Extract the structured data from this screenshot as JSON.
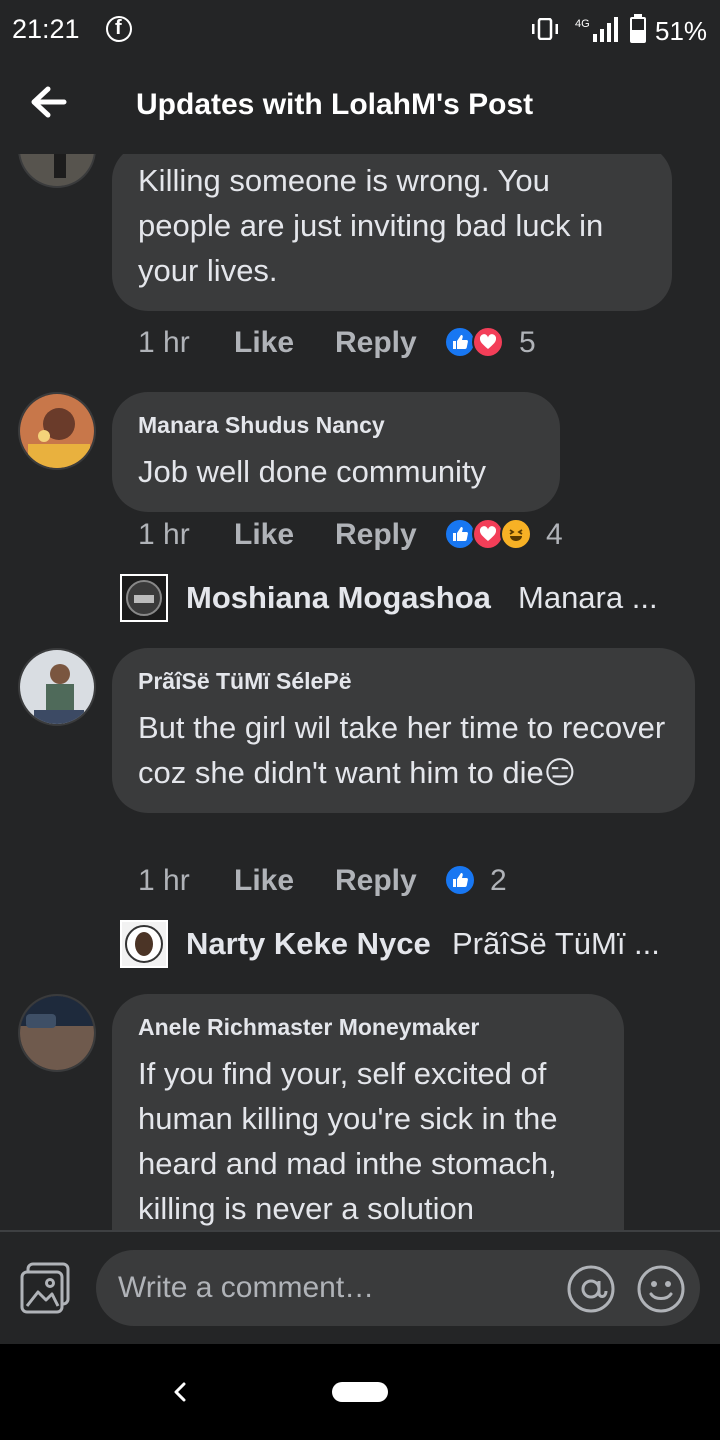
{
  "status_bar": {
    "time": "21:21",
    "network": "4G",
    "battery_percent": "51%",
    "battery_level": 0.51
  },
  "header": {
    "title": "Updates with LolahM's Post"
  },
  "comments": [
    {
      "name": "",
      "text": "Killing someone is wrong. You people are just inviting bad luck in your lives.",
      "time": "1 hr",
      "like_label": "Like",
      "reply_label": "Reply",
      "reactions": [
        "like",
        "love"
      ],
      "reaction_count": "5"
    },
    {
      "name": "Manara Shudus Nancy",
      "text": "Job well done community",
      "time": "1 hr",
      "like_label": "Like",
      "reply_label": "Reply",
      "reactions": [
        "like",
        "love",
        "haha"
      ],
      "reaction_count": "4",
      "reply_preview": {
        "name": "Moshiana Mogashoa",
        "text": "Manara ..."
      }
    },
    {
      "name": "PrãîSë TüMï SélePë",
      "text": "But the girl wil take her time to recover  coz she didn't  want him to die😑",
      "time": "1 hr",
      "like_label": "Like",
      "reply_label": "Reply",
      "reactions": [
        "like"
      ],
      "reaction_count": "2",
      "reply_preview": {
        "name": "Narty Keke Nyce",
        "text": "PrãîSë TüMï ..."
      }
    },
    {
      "name": "Anele Richmaster Moneymaker",
      "text": "If you find your, self excited of human killing you're sick in the heard and mad inthe stomach, killing is never a solution"
    }
  ],
  "composer": {
    "placeholder": "Write a comment…"
  },
  "icons": {
    "back": "arrow-left-icon",
    "photo": "photo-icon",
    "mention": "at-icon",
    "emoji": "emoji-icon",
    "like": "like-icon",
    "love": "love-icon",
    "haha": "haha-icon"
  },
  "colors": {
    "background": "#242526",
    "bubble": "#3a3b3c",
    "like": "#1877f2",
    "love": "#f33e58",
    "haha": "#f7b125"
  }
}
